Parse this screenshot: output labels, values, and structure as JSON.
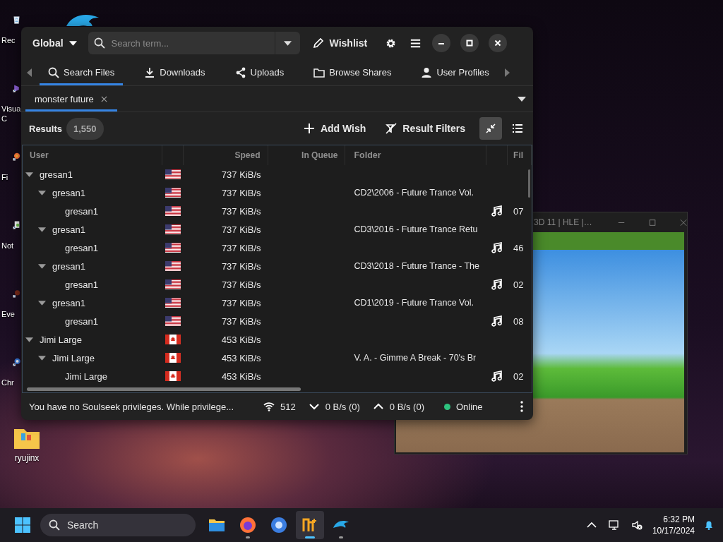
{
  "desktop_icons": [
    {
      "kind": "bin",
      "lines": [
        "Rec"
      ]
    },
    {
      "kind": "studio",
      "lines": [
        "Visua",
        "C"
      ]
    },
    {
      "kind": "firefox",
      "lines": [
        "Fi"
      ]
    },
    {
      "kind": "notepad",
      "lines": [
        "Not"
      ]
    },
    {
      "kind": "everything",
      "lines": [
        "Eve"
      ]
    },
    {
      "kind": "chrome",
      "lines": [
        "Chr"
      ]
    },
    {
      "kind": "folder",
      "lines": [
        "ryujinx"
      ]
    }
  ],
  "game_window": {
    "title": "3D 11 | HLE |…"
  },
  "app_window": {
    "scope": "Global",
    "search": {
      "placeholder": "Search term..."
    },
    "wishlist": "Wishlist",
    "tabs": [
      {
        "label": "Search Files",
        "selected": true
      },
      {
        "label": "Downloads",
        "selected": false
      },
      {
        "label": "Uploads",
        "selected": false
      },
      {
        "label": "Browse Shares",
        "selected": false
      },
      {
        "label": "User Profiles",
        "selected": false
      }
    ],
    "search_tabs": [
      {
        "label": "monster future",
        "selected": true
      }
    ],
    "results": {
      "label": "Results",
      "count": "1,550",
      "add_wish": "Add Wish",
      "filters": "Result Filters",
      "view_toggles": [
        {
          "kind": "collapse",
          "selected": true
        },
        {
          "kind": "list",
          "selected": false
        }
      ],
      "columns": [
        "User",
        "Speed",
        "In Queue",
        "Folder",
        "Fil"
      ],
      "rows": [
        {
          "user": "gresan1",
          "kind": "us",
          "speed": "737 KiB/s",
          "expanded": true,
          "children": [
            {
              "user": "gresan1",
              "kind": "us",
              "speed": "737 KiB/s",
              "folder": "CD2\\2006 - Future Trance Vol.",
              "expanded": true,
              "children": [
                {
                  "user": "gresan1",
                  "kind": "us",
                  "speed": "737 KiB/s",
                  "file": "07"
                }
              ]
            },
            {
              "user": "gresan1",
              "kind": "us",
              "speed": "737 KiB/s",
              "folder": "CD3\\2016 - Future Trance Retu",
              "expanded": true,
              "children": [
                {
                  "user": "gresan1",
                  "kind": "us",
                  "speed": "737 KiB/s",
                  "file": "46"
                }
              ]
            },
            {
              "user": "gresan1",
              "kind": "us",
              "speed": "737 KiB/s",
              "folder": "CD3\\2018 - Future Trance - The",
              "expanded": true,
              "children": [
                {
                  "user": "gresan1",
                  "kind": "us",
                  "speed": "737 KiB/s",
                  "file": "02"
                }
              ]
            },
            {
              "user": "gresan1",
              "kind": "us",
              "speed": "737 KiB/s",
              "folder": "CD1\\2019 - Future Trance Vol.",
              "expanded": true,
              "children": [
                {
                  "user": "gresan1",
                  "kind": "us",
                  "speed": "737 KiB/s",
                  "file": "08"
                }
              ]
            }
          ]
        },
        {
          "user": "Jimi Large",
          "kind": "ca",
          "speed": "453 KiB/s",
          "expanded": true,
          "children": [
            {
              "user": "Jimi Large",
              "kind": "ca",
              "speed": "453 KiB/s",
              "folder": "V. A. - Gimme A Break - 70's Br",
              "expanded": true,
              "children": [
                {
                  "user": "Jimi Large",
                  "kind": "ca",
                  "speed": "453 KiB/s",
                  "file": "02"
                }
              ]
            }
          ]
        }
      ]
    },
    "status": {
      "message": "You have no Soulseek privileges. While privilege...",
      "users": "512",
      "download": "0 B/s (0)",
      "upload": "0 B/s (0)",
      "online": true,
      "state": "Online"
    }
  },
  "taskbar": {
    "search": {
      "placeholder": "Search"
    },
    "apps": [
      {
        "kind": "files",
        "running": false,
        "selected": false
      },
      {
        "kind": "firefox",
        "running": true,
        "selected": false
      },
      {
        "kind": "chrome",
        "running": false,
        "selected": false
      },
      {
        "kind": "nicotine",
        "running": true,
        "selected": true
      },
      {
        "kind": "dolphin",
        "running": true,
        "selected": false
      }
    ],
    "time": "6:32 PM",
    "date": "10/17/2024"
  }
}
